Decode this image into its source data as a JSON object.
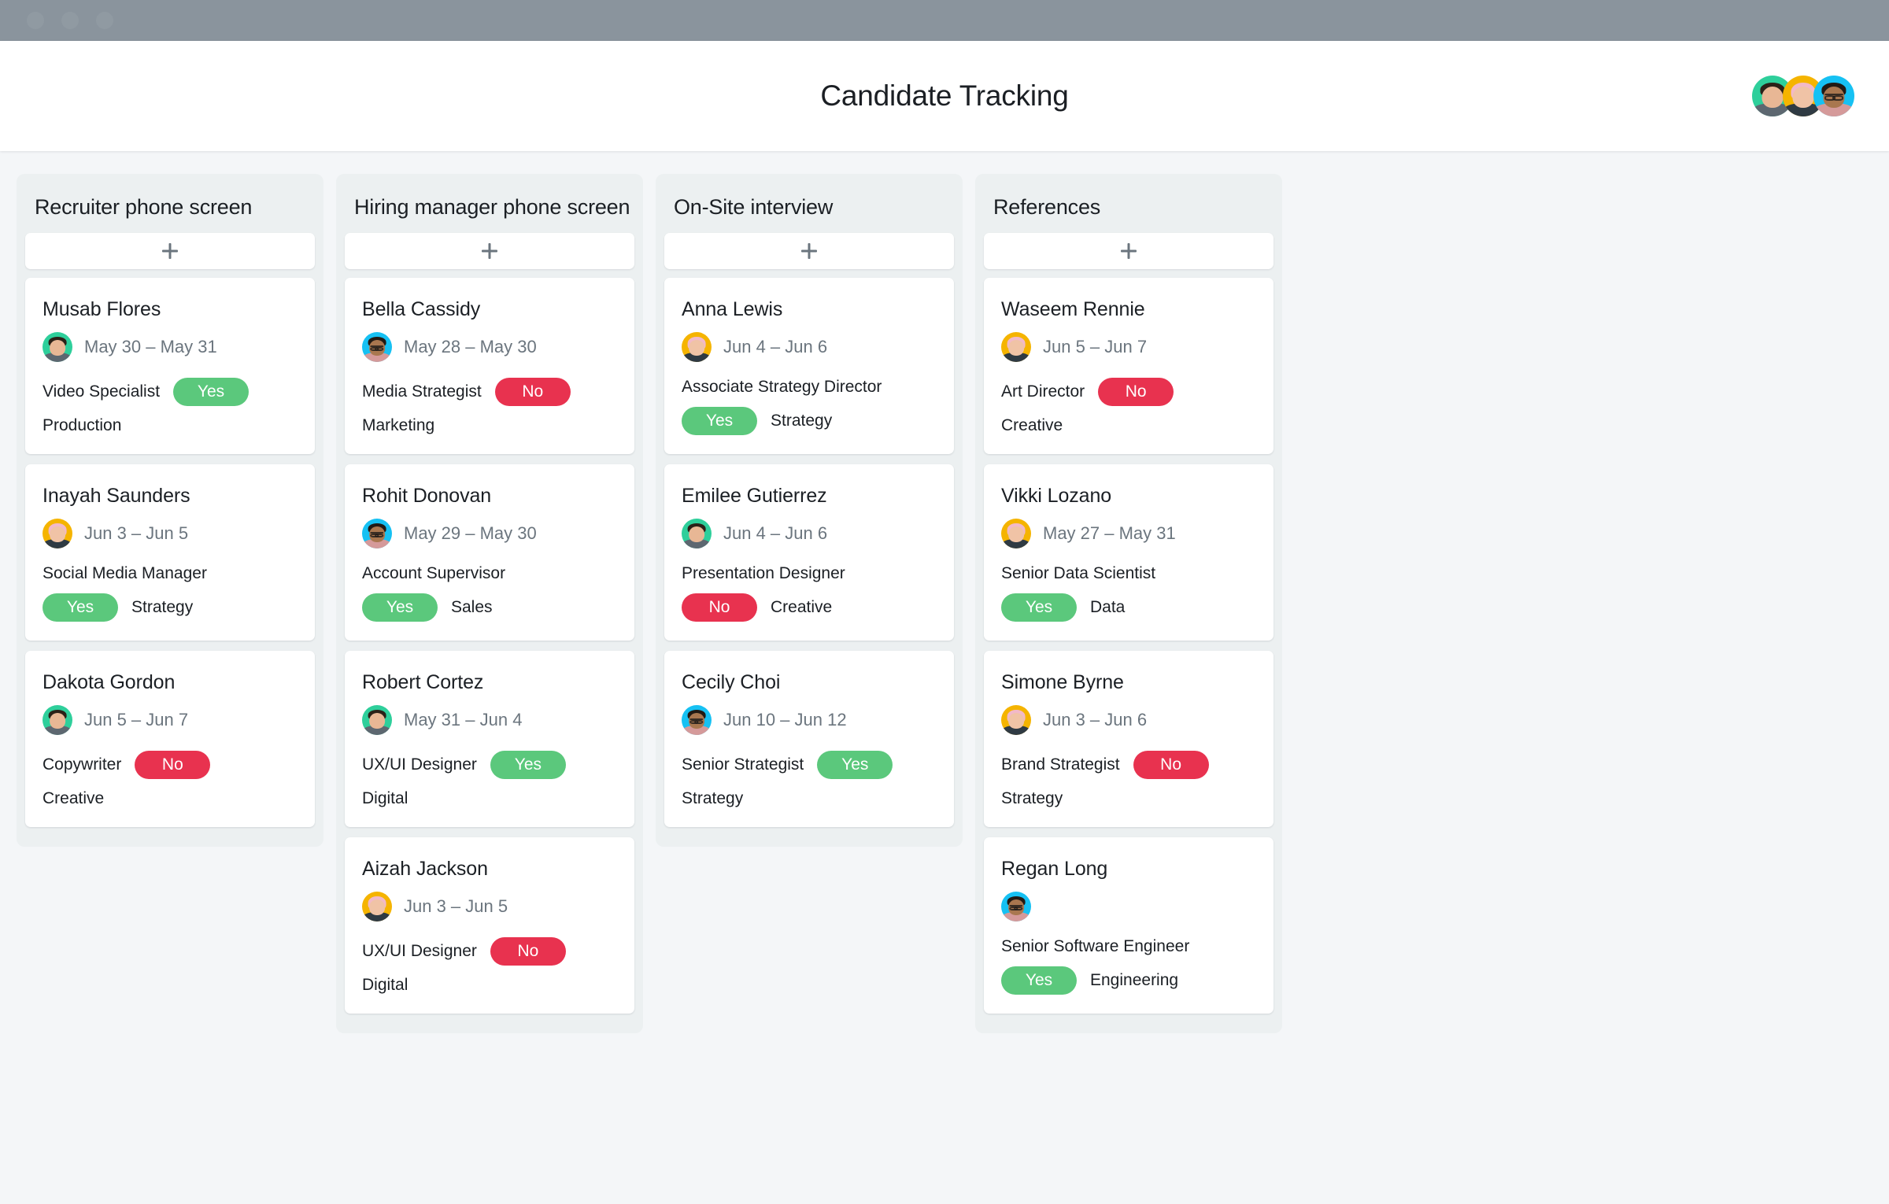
{
  "window": {
    "traffic_lights": [
      "close",
      "minimize",
      "maximize"
    ]
  },
  "header": {
    "title": "Candidate Tracking",
    "avatars": [
      {
        "name": "avatar-green",
        "color": "#2ecf9b"
      },
      {
        "name": "avatar-yellow",
        "color": "#f5b400"
      },
      {
        "name": "avatar-blue",
        "color": "#16c1f3"
      }
    ]
  },
  "theme": {
    "yes_color": "#5bc87c",
    "no_color": "#e8324f",
    "column_bg": "#ecf0f1",
    "page_bg": "#f4f6f8",
    "topbar_bg": "#8a949d"
  },
  "board": {
    "add_card_label": "+",
    "columns": [
      {
        "title": "Recruiter phone screen",
        "cards": [
          {
            "name": "Musab Flores",
            "dates": "May 30 – May 31",
            "avatar": "green",
            "role": "Video Specialist",
            "status": "Yes",
            "team": "Production",
            "layout": "role-badge-team"
          },
          {
            "name": "Inayah Saunders",
            "dates": "Jun 3 – Jun 5",
            "avatar": "yellow",
            "role": "Social Media Manager",
            "status": "Yes",
            "team": "Strategy",
            "layout": "role-then-badge-team"
          },
          {
            "name": "Dakota Gordon",
            "dates": "Jun 5 – Jun 7",
            "avatar": "green",
            "role": "Copywriter",
            "status": "No",
            "team": "Creative",
            "layout": "role-badge-team"
          }
        ]
      },
      {
        "title": "Hiring manager phone screen",
        "cards": [
          {
            "name": "Bella Cassidy",
            "dates": "May 28 – May 30",
            "avatar": "blue",
            "role": "Media Strategist",
            "status": "No",
            "team": "Marketing",
            "layout": "role-badge-team"
          },
          {
            "name": "Rohit Donovan",
            "dates": "May 29 – May 30",
            "avatar": "blue",
            "role": "Account Supervisor",
            "status": "Yes",
            "team": "Sales",
            "layout": "role-then-badge-team"
          },
          {
            "name": "Robert Cortez",
            "dates": "May 31 – Jun 4",
            "avatar": "green",
            "role": "UX/UI Designer",
            "status": "Yes",
            "team": "Digital",
            "layout": "role-badge-team"
          },
          {
            "name": "Aizah Jackson",
            "dates": "Jun 3 – Jun 5",
            "avatar": "yellow",
            "role": "UX/UI Designer",
            "status": "No",
            "team": "Digital",
            "layout": "role-badge-team"
          }
        ]
      },
      {
        "title": "On-Site interview",
        "cards": [
          {
            "name": "Anna Lewis",
            "dates": "Jun 4 – Jun 6",
            "avatar": "yellow",
            "role": "Associate Strategy Director",
            "status": "Yes",
            "team": "Strategy",
            "layout": "role-then-badge-team"
          },
          {
            "name": "Emilee Gutierrez",
            "dates": "Jun 4 – Jun 6",
            "avatar": "green",
            "role": "Presentation Designer",
            "status": "No",
            "team": "Creative",
            "layout": "role-then-badge-team"
          },
          {
            "name": "Cecily Choi",
            "dates": "Jun 10 – Jun 12",
            "avatar": "blue",
            "role": "Senior Strategist",
            "status": "Yes",
            "team": "Strategy",
            "layout": "role-badge-team"
          }
        ]
      },
      {
        "title": "References",
        "cards": [
          {
            "name": "Waseem Rennie",
            "dates": "Jun 5 – Jun 7",
            "avatar": "yellow",
            "role": "Art Director",
            "status": "No",
            "team": "Creative",
            "layout": "role-badge-team"
          },
          {
            "name": "Vikki Lozano",
            "dates": "May 27 – May 31",
            "avatar": "yellow",
            "role": "Senior Data Scientist",
            "status": "Yes",
            "team": "Data",
            "layout": "role-then-badge-team"
          },
          {
            "name": "Simone Byrne",
            "dates": "Jun 3 – Jun 6",
            "avatar": "yellow",
            "role": "Brand Strategist",
            "status": "No",
            "team": "Strategy",
            "layout": "role-badge-team"
          },
          {
            "name": "Regan Long",
            "dates": "",
            "avatar": "blue",
            "role": "Senior Software Engineer",
            "status": "Yes",
            "team": "Engineering",
            "layout": "role-then-badge-team"
          }
        ]
      }
    ]
  }
}
